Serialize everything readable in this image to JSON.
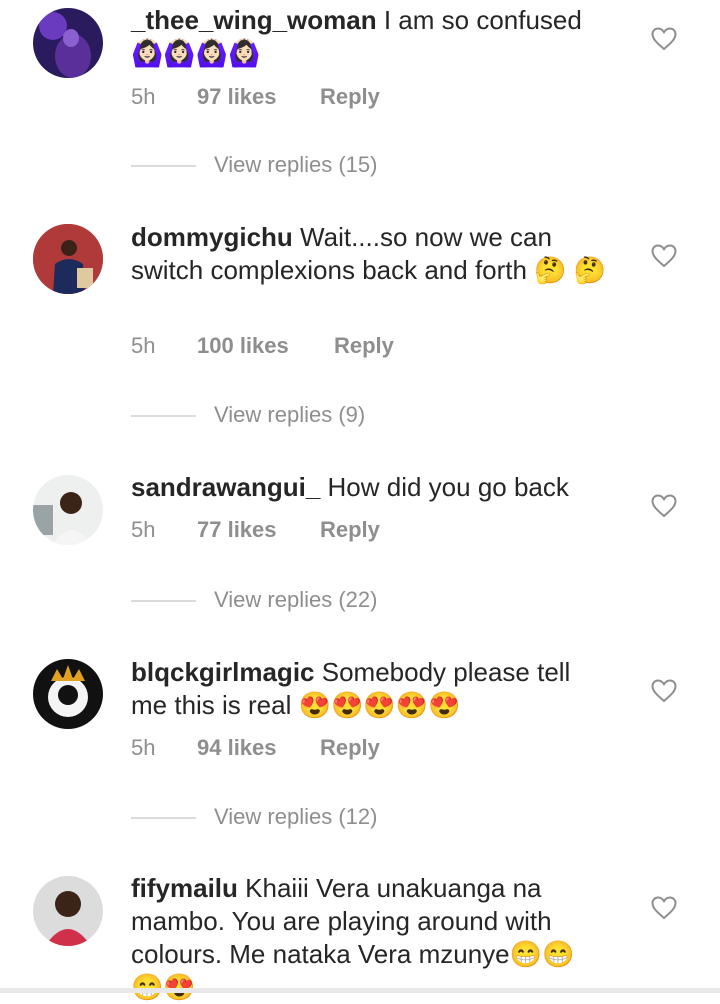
{
  "comments": [
    {
      "username": "_thee_wing_woman",
      "text": "I am so confused",
      "emojis": [
        "🙆🏻‍♀️",
        "🙆🏻‍♀️",
        "🙆🏻‍♀️",
        "🙆🏻‍♀️"
      ],
      "time": "5h",
      "likes": "97 likes",
      "reply": "Reply",
      "view_replies": "View replies (15)"
    },
    {
      "username": "dommygichu",
      "text": "Wait....so now we can switch complexions back and forth",
      "emojis": [
        "🤔",
        "🤔"
      ],
      "time": "5h",
      "likes": "100 likes",
      "reply": "Reply",
      "view_replies": "View replies (9)"
    },
    {
      "username": "sandrawangui_",
      "text": "How did you go back",
      "emojis": [],
      "time": "5h",
      "likes": "77 likes",
      "reply": "Reply",
      "view_replies": "View replies (22)"
    },
    {
      "username": "blqckgirlmagic",
      "text": "Somebody please tell me this is real",
      "emojis": [
        "😍",
        "😍",
        "😍",
        "😍",
        "😍"
      ],
      "time": "5h",
      "likes": "94 likes",
      "reply": "Reply",
      "view_replies": "View replies (12)"
    },
    {
      "username": "fifymailu",
      "text": "Khaiii Vera unakuanga na mambo. You are playing around with colours. Me nataka Vera mzunye",
      "emojis": [
        "😁",
        "😁",
        "😁",
        "😍"
      ]
    }
  ],
  "icons": {
    "like": "heart-outline-icon"
  },
  "colors": {
    "secondary_text": "#8e8e8e",
    "primary_text": "#262626",
    "divider": "#dbdbdb"
  }
}
